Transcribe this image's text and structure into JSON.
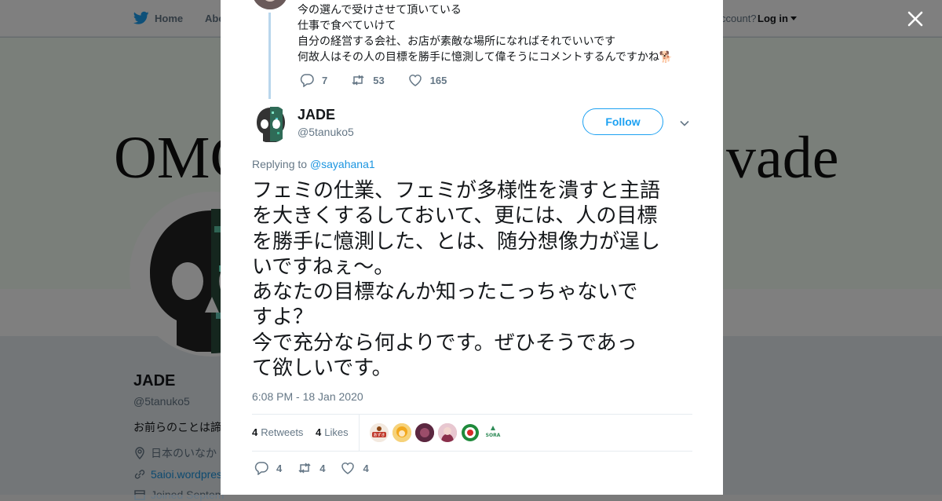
{
  "site_nav": {
    "home": "Home",
    "about": "Abo",
    "account_prompt": "ccount?",
    "login": "Log in"
  },
  "banner": {
    "left_text": "OMG",
    "right_text": "vade"
  },
  "profile": {
    "name": "JADE",
    "handle": "@5tanuko5",
    "bio": "お前らのことは諦",
    "location": "日本のいなか",
    "url": "5aioi.wordpres",
    "joined": "Joined Septem"
  },
  "previous_tweet": {
    "lines": [
      "今の選んで受けさせて頂いている",
      "仕事で食べていけて",
      "自分の経営する会社、お店が素敵な場所になればそれでいいです",
      "何故人はその人の目標を勝手に憶測して偉そうにコメントするんですかね🐕"
    ],
    "replies": "7",
    "retweets": "53",
    "likes": "165"
  },
  "tweet": {
    "author_name": "JADE",
    "author_handle": "@5tanuko5",
    "follow_label": "Follow",
    "replying_prefix": "Replying to",
    "replying_to": "@sayahana1",
    "body_lines": [
      "フェミの仕業、フェミが多様性を潰すと主語",
      "を大きくするしておいて、更には、人の目標",
      "を勝手に憶測した、とは、随分想像力が逞し",
      "いですねぇ〜。",
      "あなたの目標なんか知ったこっちゃないで",
      "すよ？",
      "今で充分なら何よりです。ぜひそうであっ",
      "て欲しいです。"
    ],
    "timestamp": "6:08 PM - 18 Jan 2020",
    "retweet_count": "4",
    "retweet_label": "Retweets",
    "like_count": "4",
    "like_label": "Likes",
    "likers": [
      "liker-1",
      "liker-2",
      "liker-3",
      "liker-4",
      "liker-5",
      "liker-6"
    ],
    "liker_badge_1": "あずき",
    "liker_badge_6": "SORA",
    "replies": "4",
    "retweets": "4",
    "likes": "4"
  },
  "colors": {
    "accent": "#1da1f2",
    "link": "#1b95e0",
    "text": "#14171a",
    "muted": "#657786",
    "thread_line": "#b9d6ec"
  }
}
